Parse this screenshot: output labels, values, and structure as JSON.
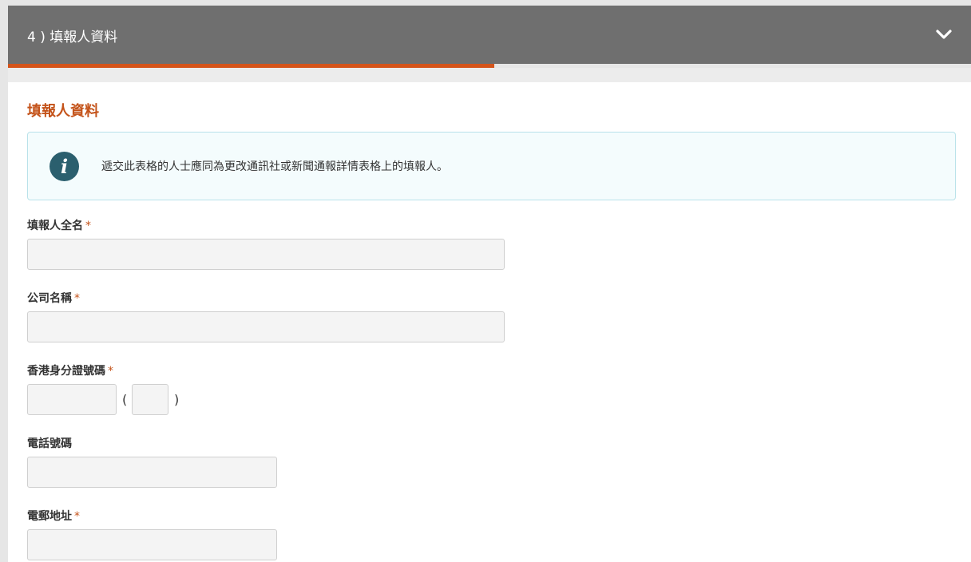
{
  "panel": {
    "title": "4 ) 填報人資料",
    "progress_fraction": 0.505
  },
  "section": {
    "title": "填報人資料"
  },
  "info": {
    "text": "遞交此表格的人士應同為更改通訊社或新聞通報詳情表格上的填報人。"
  },
  "fields": {
    "full_name": {
      "label": "填報人全名",
      "required": "*",
      "value": ""
    },
    "company": {
      "label": "公司名稱",
      "required": "*",
      "value": ""
    },
    "hkid": {
      "label": "香港身分證號碼",
      "required": "*",
      "main_value": "",
      "check_digit": "",
      "open_paren": "(",
      "close_paren": ")"
    },
    "phone": {
      "label": "電話號碼",
      "value": ""
    },
    "email": {
      "label": "電郵地址",
      "required": "*",
      "value": ""
    }
  },
  "colors": {
    "header_bg": "#6f6f6f",
    "accent": "#d4541b",
    "section_title": "#c4531a",
    "info_icon": "#2b5f6e"
  }
}
